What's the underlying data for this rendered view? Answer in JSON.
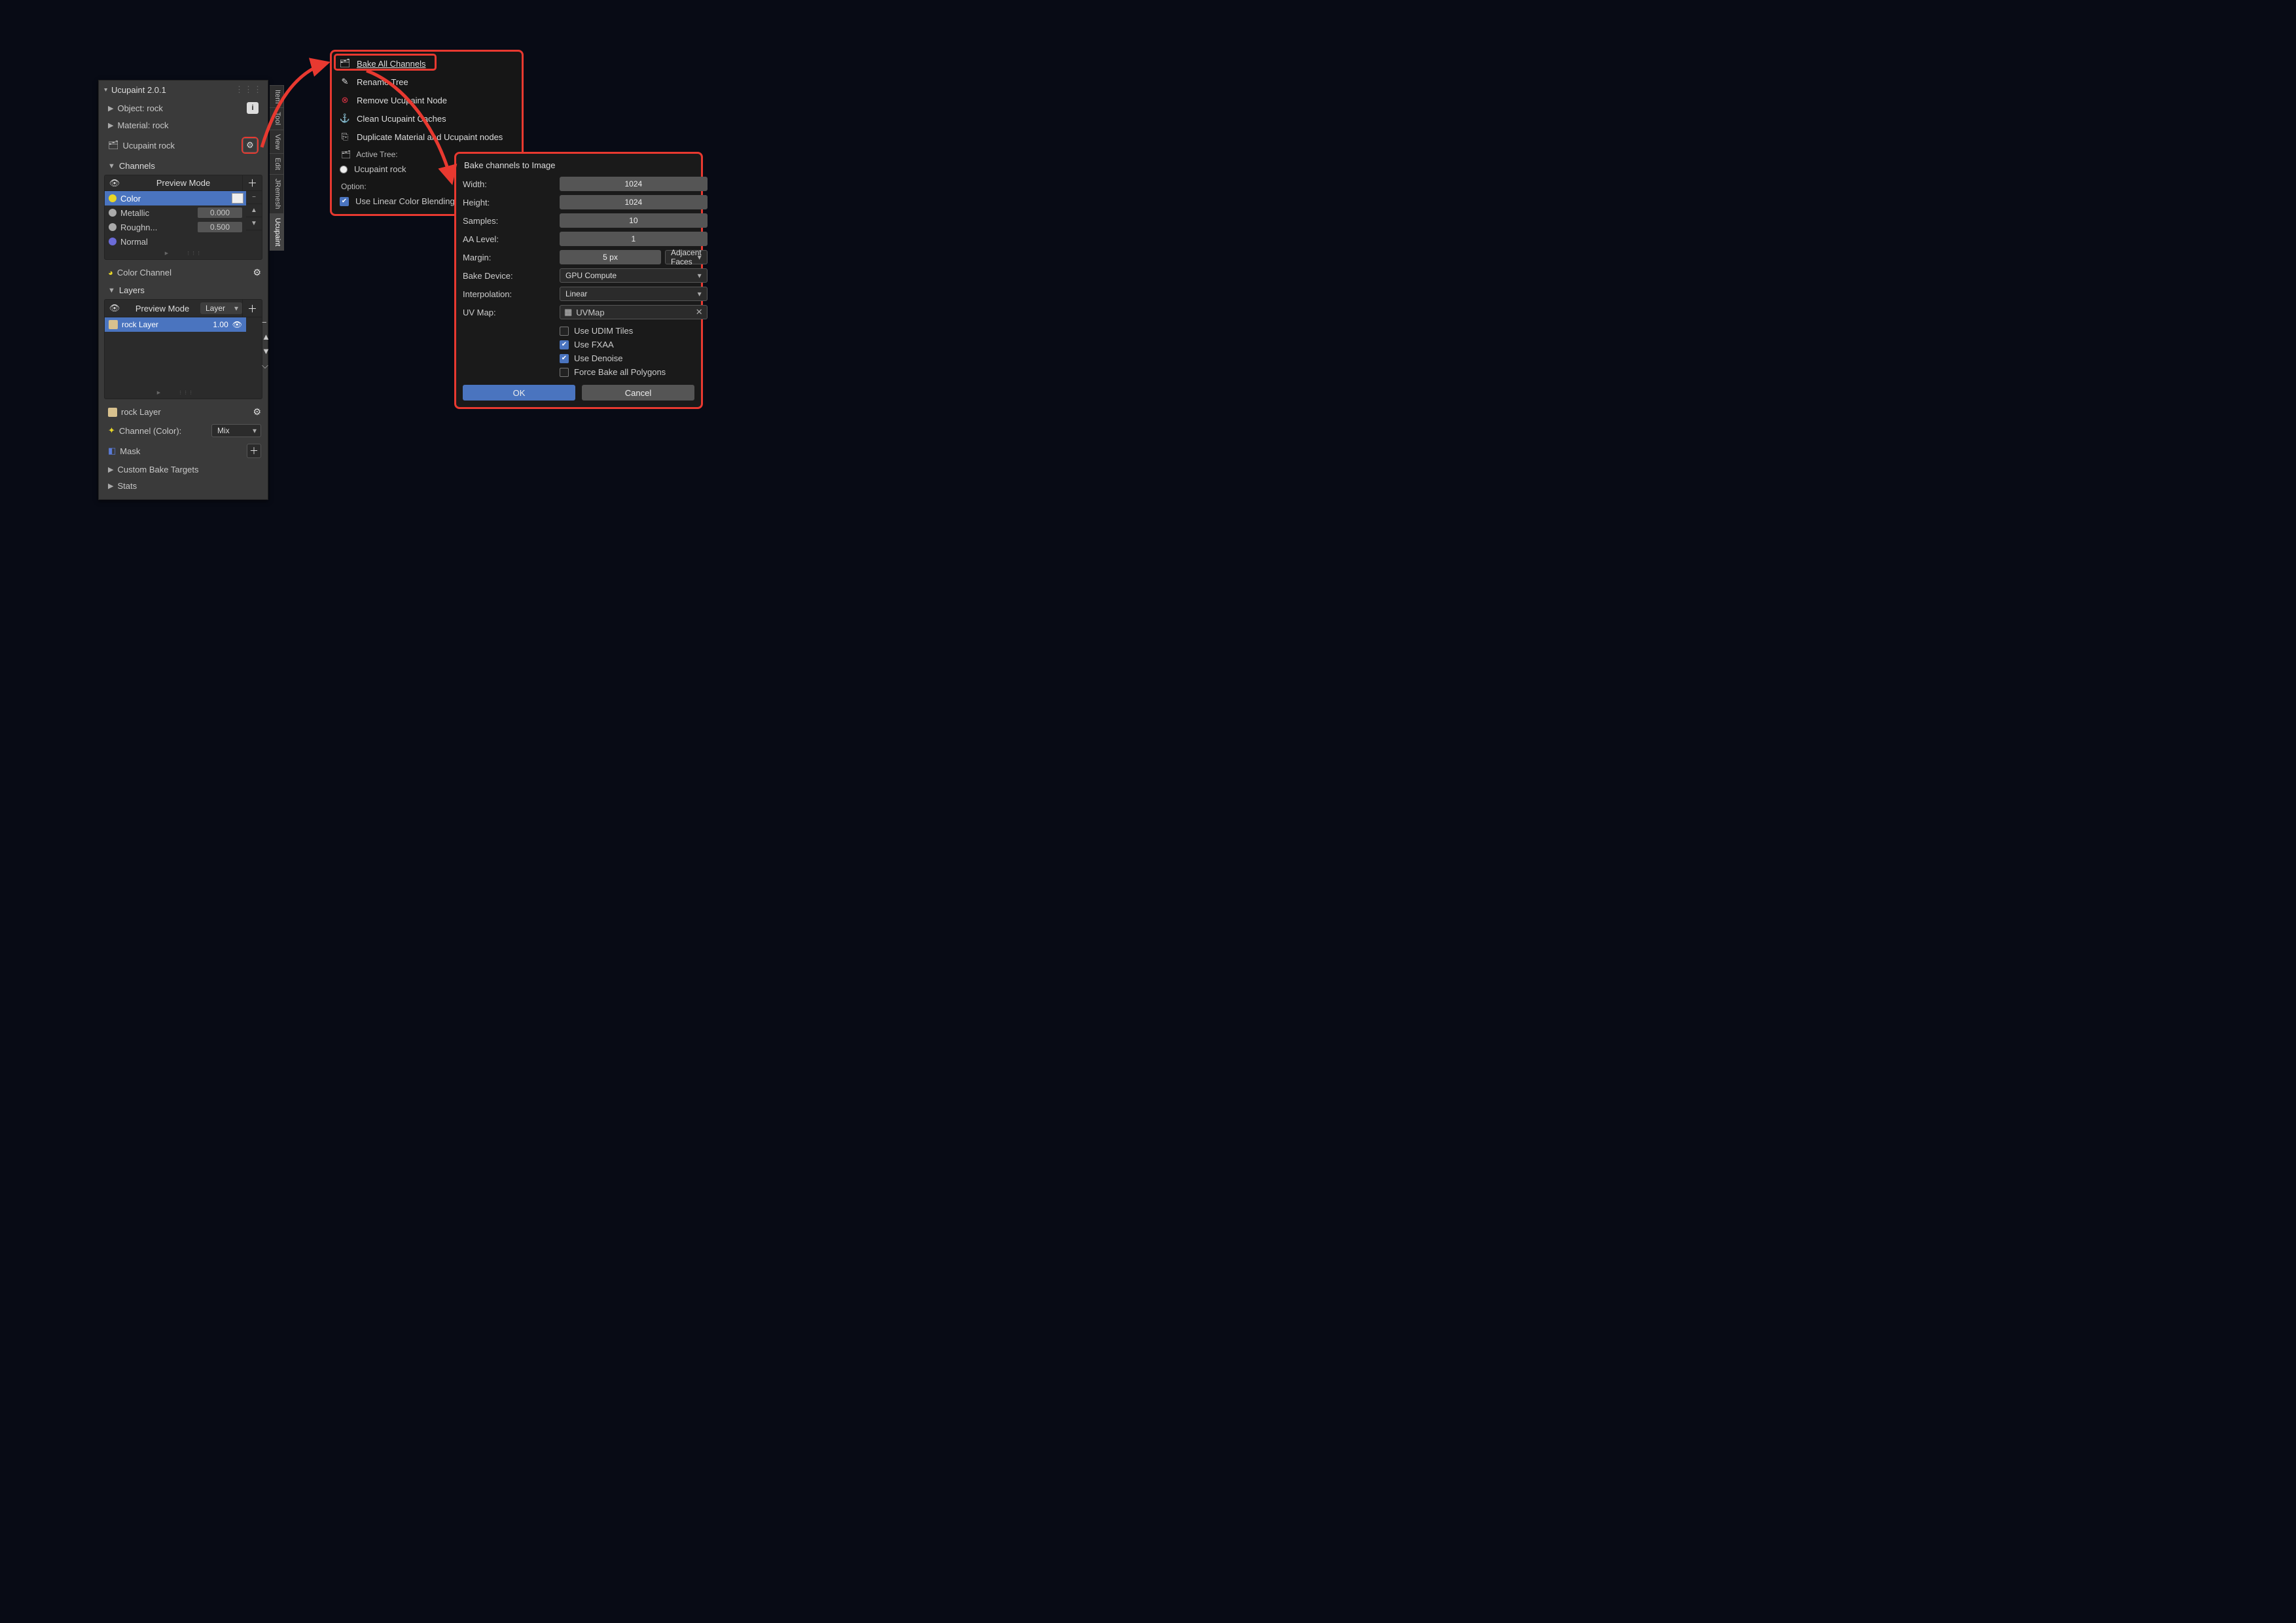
{
  "panel": {
    "title": "Ucupaint 2.0.1",
    "object_label": "Object: rock",
    "material_label": "Material: rock",
    "node_label": "Ucupaint rock",
    "channels_label": "Channels",
    "preview_label": "Preview Mode",
    "channels": [
      {
        "name": "Color",
        "dot": "#e8d628",
        "value": "",
        "swatch": true,
        "selected": true
      },
      {
        "name": "Metallic",
        "dot": "#aaaaaa",
        "value": "0.000",
        "swatch": false,
        "selected": false
      },
      {
        "name": "Roughn...",
        "dot": "#aaaaaa",
        "value": "0.500",
        "swatch": false,
        "selected": false
      },
      {
        "name": "Normal",
        "dot": "#6b6bd8",
        "value": "",
        "swatch": false,
        "selected": false
      }
    ],
    "color_channel_label": "Color Channel",
    "layers_label": "Layers",
    "layer_preview_label": "Preview Mode",
    "layer_scope": "Layer",
    "layer_name": "rock Layer",
    "layer_opacity": "1.00",
    "layer_footer_name": "rock Layer",
    "channel_selector_label": "Channel (Color):",
    "channel_selector_value": "Mix",
    "mask_label": "Mask",
    "custom_bake_label": "Custom Bake Targets",
    "stats_label": "Stats"
  },
  "tabs": [
    "Item",
    "Tool",
    "View",
    "Edit",
    "JRemesh",
    "Ucupaint"
  ],
  "menu": {
    "items": [
      {
        "icon": "🗂",
        "label": "Bake All Channels",
        "hl": true
      },
      {
        "icon": "✎",
        "label": "Rename Tree"
      },
      {
        "icon": "⊗",
        "label": "Remove Ucupaint Node",
        "iconcolor": "#d34"
      },
      {
        "icon": "⚓",
        "label": "Clean Ucupaint Caches"
      },
      {
        "icon": "⎘",
        "label": "Duplicate Material and Ucupaint nodes"
      }
    ],
    "active_tree_label": "Active Tree:",
    "active_tree_value": "Ucupaint rock",
    "option_label": "Option:",
    "option_value": "Use Linear Color Blending",
    "option_checked": true
  },
  "dialog": {
    "title": "Bake channels to Image",
    "width_label": "Width:",
    "width_value": "1024",
    "height_label": "Height:",
    "height_value": "1024",
    "samples_label": "Samples:",
    "samples_value": "10",
    "aa_label": "AA Level:",
    "aa_value": "1",
    "margin_label": "Margin:",
    "margin_value": "5 px",
    "margin_mode": "Adjacent Faces",
    "device_label": "Bake Device:",
    "device_value": "GPU Compute",
    "interp_label": "Interpolation:",
    "interp_value": "Linear",
    "uv_label": "UV Map:",
    "uv_value": "UVMap",
    "chk_udim": {
      "label": "Use UDIM Tiles",
      "on": false
    },
    "chk_fxaa": {
      "label": "Use FXAA",
      "on": true
    },
    "chk_dn": {
      "label": "Use Denoise",
      "on": true
    },
    "chk_force": {
      "label": "Force Bake all Polygons",
      "on": false
    },
    "ok": "OK",
    "cancel": "Cancel"
  }
}
